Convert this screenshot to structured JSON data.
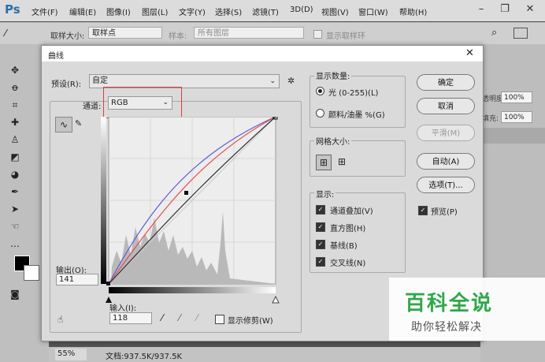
{
  "app": {
    "logo": "Ps"
  },
  "menu": [
    "文件(F)",
    "编辑(E)",
    "图像(I)",
    "图层(L)",
    "文字(Y)",
    "选择(S)",
    "滤镜(T)",
    "3D(D)",
    "视图(V)",
    "窗口(W)",
    "帮助(H)"
  ],
  "window_controls": {
    "minimize": "–",
    "restore": "❐",
    "close": "✕"
  },
  "options": {
    "sample_size_label": "取样大小:",
    "sample_size_value": "取样点",
    "sample_label": "样本:",
    "sample_value": "所有图层",
    "show_ring": "显示取样环"
  },
  "right_panel": {
    "opacity_label": "透明度:",
    "opacity_value": "100%",
    "fill_label": "填充:",
    "fill_value": "100%"
  },
  "status": {
    "zoom": "55%",
    "doc": "文档:937.5K/937.5K"
  },
  "dialog": {
    "title": "曲线",
    "close": "✕",
    "preset_label": "预设(R):",
    "preset_value": "自定",
    "channel_label": "通道:",
    "channel_value": "RGB",
    "output_label": "输出(O):",
    "output_value": "141",
    "input_label": "输入(I):",
    "input_value": "118",
    "show_clipping": "显示修剪(W)",
    "show_amount": {
      "title": "显示数量:",
      "light": "光 (0-255)(L)",
      "pigment": "颜料/油墨 %(G)"
    },
    "grid_size": {
      "title": "网格大小:"
    },
    "show": {
      "title": "显示:",
      "overlay": "通道叠加(V)",
      "histogram": "直方图(H)",
      "baseline": "基线(B)",
      "intersection": "交叉线(N)"
    },
    "buttons": {
      "ok": "确定",
      "cancel": "取消",
      "smooth": "平滑(M)",
      "auto": "自动(A)",
      "options": "选项(T)..."
    },
    "preview": "预览(P)"
  },
  "watermark": {
    "title": "百科全说",
    "subtitle": "助你轻松解决"
  },
  "colors": {
    "highlight_box": "#e63b3b",
    "curve_red": "#e0504f",
    "curve_blue": "#5a5ad8",
    "curve_black": "#333333"
  }
}
